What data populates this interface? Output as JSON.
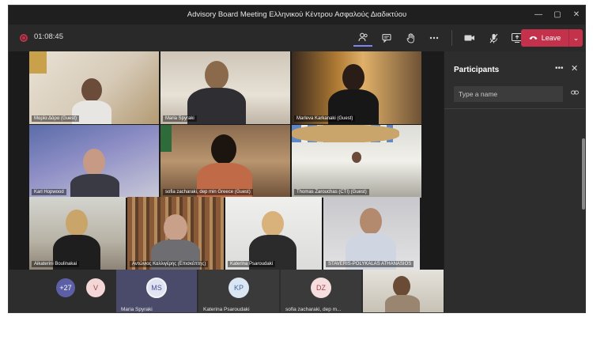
{
  "window": {
    "title": "Advisory Board Meeting Ελληνικού Κέντρου Ασφαλούς Διαδικτύου",
    "controls": {
      "minimize": "—",
      "maximize": "▢",
      "close": "✕"
    }
  },
  "toolbar": {
    "timer": "01:08:45",
    "leave_label": "Leave",
    "icons": [
      "participants-icon",
      "chat-icon",
      "raise-hand-icon",
      "more-icon",
      "camera-icon",
      "mic-off-icon",
      "share-screen-icon"
    ]
  },
  "grid": {
    "tiles": [
      {
        "name": "Μαρία Δάρα (Guest)"
      },
      {
        "name": "Maria Spyraki"
      },
      {
        "name": "Marleva Karkanaki (Guest)"
      },
      {
        "name": "Karl Hopwood"
      },
      {
        "name": "sofia zacharaki, dep min Greece (Guest)"
      },
      {
        "name": "Thomas Zarouchas (CTI) (Guest)"
      },
      {
        "name": "Aikaterini Boulinakai"
      },
      {
        "name": "Αντώνιος Καλλιγέρης (Επισκέπτης)"
      },
      {
        "name": "Katerina Psaroudaki"
      },
      {
        "name": "STAVERIS-POLYKALAS ATHANASIOS"
      }
    ]
  },
  "strip": {
    "overflow_count": "+27",
    "v_initial": "V",
    "tiles": [
      {
        "initials": "MS",
        "name": "Maria Spyraki"
      },
      {
        "initials": "KP",
        "name": "Katerina Psaroudaki"
      },
      {
        "initials": "DZ",
        "name": "sofia zacharaki, dep m..."
      }
    ]
  },
  "panel": {
    "title": "Participants",
    "search_placeholder": "Type a name"
  },
  "colors": {
    "leave": "#c4314b",
    "accent": "#7f85f5"
  }
}
